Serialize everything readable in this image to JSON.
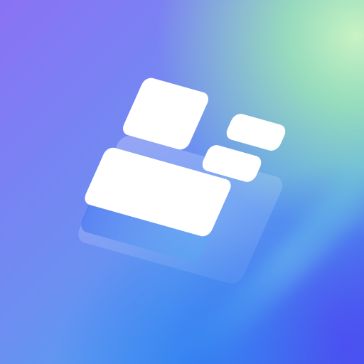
{
  "icon": {
    "name": "stacked-layout-widgets-app-icon",
    "colors": {
      "violet": "#8a72f4",
      "blue": "#4f86f2",
      "cyan": "#5fd8ee",
      "mint": "#9fe8b4",
      "deep_blue": "#4d5cf0",
      "tile": "#ffffff"
    }
  }
}
